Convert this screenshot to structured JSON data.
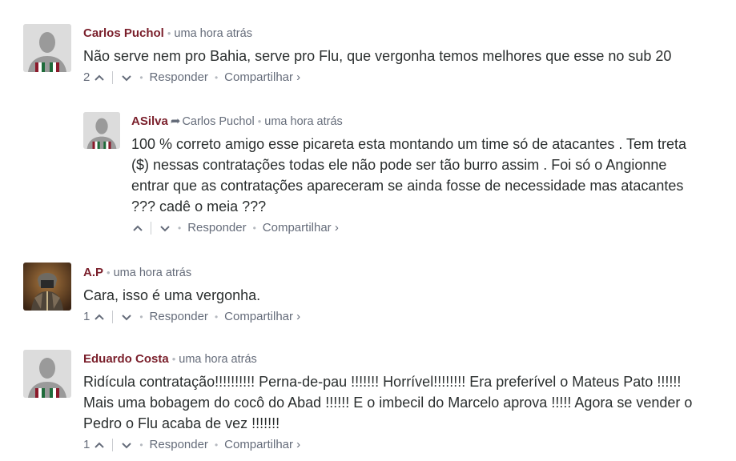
{
  "comments": [
    {
      "author": "Carlos Puchol",
      "time": "uma hora atrás",
      "text": "Não serve nem pro Bahia, serve pro Flu, que vergonha temos melhores que esse no sub 20",
      "votes": "2",
      "reply_label": "Responder",
      "share_label": "Compartilhar ›"
    },
    {
      "author": "ASilva",
      "reply_to": "Carlos Puchol",
      "time": "uma hora atrás",
      "text_lines": [
        "100 % correto amigo esse picareta esta montando um time só de atacantes . Tem treta",
        "($) nessas contratações todas ele não pode ser tão burro assim . Foi só o Angionne",
        "entrar que as contratações apareceram se ainda fosse de necessidade mas atacantes",
        "??? cadê o meia ???"
      ],
      "reply_label": "Responder",
      "share_label": "Compartilhar ›"
    },
    {
      "author": "A.P",
      "time": "uma hora atrás",
      "text": "Cara, isso é uma vergonha.",
      "votes": "1",
      "reply_label": "Responder",
      "share_label": "Compartilhar ›"
    },
    {
      "author": "Eduardo Costa",
      "time": "uma hora atrás",
      "text_lines": [
        "Ridícula contratação!!!!!!!!!! Perna-de-pau !!!!!!! Horrível!!!!!!!! Era preferível o Mateus Pato !!!!!!",
        "Mais uma bobagem do cocô do Abad !!!!!! E o imbecil do Marcelo aprova !!!!! Agora se vender o",
        "Pedro o Flu acaba de vez !!!!!!!"
      ],
      "votes": "1",
      "reply_label": "Responder",
      "share_label": "Compartilhar ›"
    }
  ],
  "colors": {
    "author": "#7a1f2b",
    "meta": "#656c7a",
    "text": "#2a2e2e"
  },
  "icons": {
    "upvote": "chevron-up-icon",
    "downvote": "chevron-down-icon",
    "reply_arrow": "reply-arrow-icon"
  }
}
